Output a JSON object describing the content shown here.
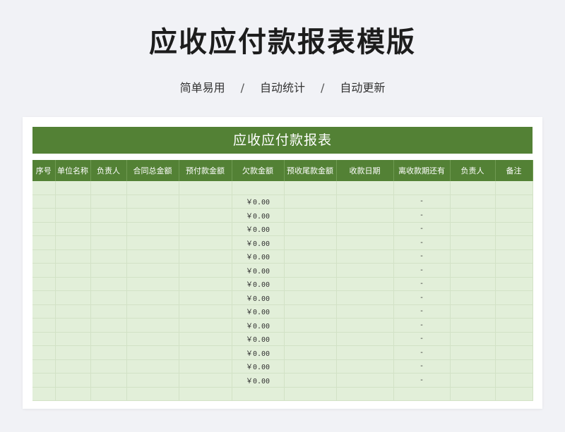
{
  "header": {
    "title": "应收应付款报表模版",
    "features": [
      "简单易用",
      "自动统计",
      "自动更新"
    ],
    "separator": "/"
  },
  "sheet": {
    "title": "应收应付款报表",
    "columns": [
      "序号",
      "单位名称",
      "负责人",
      "合同总金额",
      "预付款金额",
      "欠款金额",
      "预收尾款金额",
      "收款日期",
      "离收款期还有",
      "负责人",
      "备注"
    ],
    "rows": [
      [
        "",
        "",
        "",
        "",
        "",
        "",
        "",
        "",
        "",
        "",
        ""
      ],
      [
        "",
        "",
        "",
        "",
        "",
        "￥0.00",
        "",
        "",
        "-",
        "",
        ""
      ],
      [
        "",
        "",
        "",
        "",
        "",
        "￥0.00",
        "",
        "",
        "-",
        "",
        ""
      ],
      [
        "",
        "",
        "",
        "",
        "",
        "￥0.00",
        "",
        "",
        "-",
        "",
        ""
      ],
      [
        "",
        "",
        "",
        "",
        "",
        "￥0.00",
        "",
        "",
        "-",
        "",
        ""
      ],
      [
        "",
        "",
        "",
        "",
        "",
        "￥0.00",
        "",
        "",
        "-",
        "",
        ""
      ],
      [
        "",
        "",
        "",
        "",
        "",
        "￥0.00",
        "",
        "",
        "-",
        "",
        ""
      ],
      [
        "",
        "",
        "",
        "",
        "",
        "￥0.00",
        "",
        "",
        "-",
        "",
        ""
      ],
      [
        "",
        "",
        "",
        "",
        "",
        "￥0.00",
        "",
        "",
        "-",
        "",
        ""
      ],
      [
        "",
        "",
        "",
        "",
        "",
        "￥0.00",
        "",
        "",
        "-",
        "",
        ""
      ],
      [
        "",
        "",
        "",
        "",
        "",
        "￥0.00",
        "",
        "",
        "-",
        "",
        ""
      ],
      [
        "",
        "",
        "",
        "",
        "",
        "￥0.00",
        "",
        "",
        "-",
        "",
        ""
      ],
      [
        "",
        "",
        "",
        "",
        "",
        "￥0.00",
        "",
        "",
        "-",
        "",
        ""
      ],
      [
        "",
        "",
        "",
        "",
        "",
        "￥0.00",
        "",
        "",
        "-",
        "",
        ""
      ],
      [
        "",
        "",
        "",
        "",
        "",
        "￥0.00",
        "",
        "",
        "-",
        "",
        ""
      ],
      [
        "",
        "",
        "",
        "",
        "",
        "",
        "",
        "",
        "",
        "",
        ""
      ]
    ]
  },
  "colors": {
    "header_green": "#538135",
    "cell_green": "#e2efd9",
    "page_background": "#f1f2f6"
  }
}
